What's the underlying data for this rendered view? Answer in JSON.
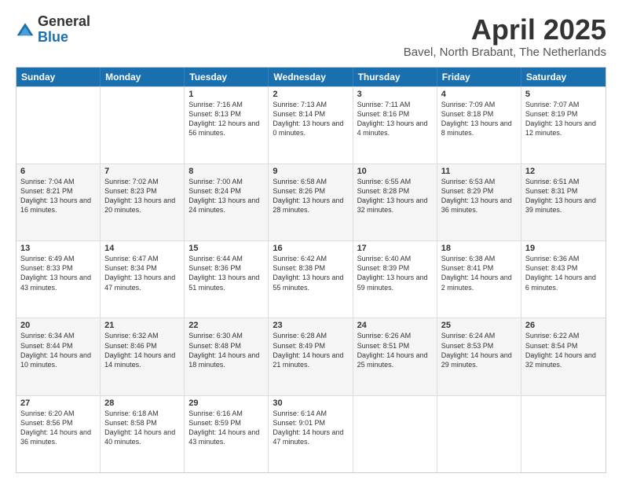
{
  "logo": {
    "general": "General",
    "blue": "Blue"
  },
  "title": "April 2025",
  "location": "Bavel, North Brabant, The Netherlands",
  "days_of_week": [
    "Sunday",
    "Monday",
    "Tuesday",
    "Wednesday",
    "Thursday",
    "Friday",
    "Saturday"
  ],
  "weeks": [
    [
      {
        "day": "",
        "text": ""
      },
      {
        "day": "",
        "text": ""
      },
      {
        "day": "1",
        "text": "Sunrise: 7:16 AM\nSunset: 8:13 PM\nDaylight: 12 hours and 56 minutes."
      },
      {
        "day": "2",
        "text": "Sunrise: 7:13 AM\nSunset: 8:14 PM\nDaylight: 13 hours and 0 minutes."
      },
      {
        "day": "3",
        "text": "Sunrise: 7:11 AM\nSunset: 8:16 PM\nDaylight: 13 hours and 4 minutes."
      },
      {
        "day": "4",
        "text": "Sunrise: 7:09 AM\nSunset: 8:18 PM\nDaylight: 13 hours and 8 minutes."
      },
      {
        "day": "5",
        "text": "Sunrise: 7:07 AM\nSunset: 8:19 PM\nDaylight: 13 hours and 12 minutes."
      }
    ],
    [
      {
        "day": "6",
        "text": "Sunrise: 7:04 AM\nSunset: 8:21 PM\nDaylight: 13 hours and 16 minutes."
      },
      {
        "day": "7",
        "text": "Sunrise: 7:02 AM\nSunset: 8:23 PM\nDaylight: 13 hours and 20 minutes."
      },
      {
        "day": "8",
        "text": "Sunrise: 7:00 AM\nSunset: 8:24 PM\nDaylight: 13 hours and 24 minutes."
      },
      {
        "day": "9",
        "text": "Sunrise: 6:58 AM\nSunset: 8:26 PM\nDaylight: 13 hours and 28 minutes."
      },
      {
        "day": "10",
        "text": "Sunrise: 6:55 AM\nSunset: 8:28 PM\nDaylight: 13 hours and 32 minutes."
      },
      {
        "day": "11",
        "text": "Sunrise: 6:53 AM\nSunset: 8:29 PM\nDaylight: 13 hours and 36 minutes."
      },
      {
        "day": "12",
        "text": "Sunrise: 6:51 AM\nSunset: 8:31 PM\nDaylight: 13 hours and 39 minutes."
      }
    ],
    [
      {
        "day": "13",
        "text": "Sunrise: 6:49 AM\nSunset: 8:33 PM\nDaylight: 13 hours and 43 minutes."
      },
      {
        "day": "14",
        "text": "Sunrise: 6:47 AM\nSunset: 8:34 PM\nDaylight: 13 hours and 47 minutes."
      },
      {
        "day": "15",
        "text": "Sunrise: 6:44 AM\nSunset: 8:36 PM\nDaylight: 13 hours and 51 minutes."
      },
      {
        "day": "16",
        "text": "Sunrise: 6:42 AM\nSunset: 8:38 PM\nDaylight: 13 hours and 55 minutes."
      },
      {
        "day": "17",
        "text": "Sunrise: 6:40 AM\nSunset: 8:39 PM\nDaylight: 13 hours and 59 minutes."
      },
      {
        "day": "18",
        "text": "Sunrise: 6:38 AM\nSunset: 8:41 PM\nDaylight: 14 hours and 2 minutes."
      },
      {
        "day": "19",
        "text": "Sunrise: 6:36 AM\nSunset: 8:43 PM\nDaylight: 14 hours and 6 minutes."
      }
    ],
    [
      {
        "day": "20",
        "text": "Sunrise: 6:34 AM\nSunset: 8:44 PM\nDaylight: 14 hours and 10 minutes."
      },
      {
        "day": "21",
        "text": "Sunrise: 6:32 AM\nSunset: 8:46 PM\nDaylight: 14 hours and 14 minutes."
      },
      {
        "day": "22",
        "text": "Sunrise: 6:30 AM\nSunset: 8:48 PM\nDaylight: 14 hours and 18 minutes."
      },
      {
        "day": "23",
        "text": "Sunrise: 6:28 AM\nSunset: 8:49 PM\nDaylight: 14 hours and 21 minutes."
      },
      {
        "day": "24",
        "text": "Sunrise: 6:26 AM\nSunset: 8:51 PM\nDaylight: 14 hours and 25 minutes."
      },
      {
        "day": "25",
        "text": "Sunrise: 6:24 AM\nSunset: 8:53 PM\nDaylight: 14 hours and 29 minutes."
      },
      {
        "day": "26",
        "text": "Sunrise: 6:22 AM\nSunset: 8:54 PM\nDaylight: 14 hours and 32 minutes."
      }
    ],
    [
      {
        "day": "27",
        "text": "Sunrise: 6:20 AM\nSunset: 8:56 PM\nDaylight: 14 hours and 36 minutes."
      },
      {
        "day": "28",
        "text": "Sunrise: 6:18 AM\nSunset: 8:58 PM\nDaylight: 14 hours and 40 minutes."
      },
      {
        "day": "29",
        "text": "Sunrise: 6:16 AM\nSunset: 8:59 PM\nDaylight: 14 hours and 43 minutes."
      },
      {
        "day": "30",
        "text": "Sunrise: 6:14 AM\nSunset: 9:01 PM\nDaylight: 14 hours and 47 minutes."
      },
      {
        "day": "",
        "text": ""
      },
      {
        "day": "",
        "text": ""
      },
      {
        "day": "",
        "text": ""
      }
    ]
  ]
}
